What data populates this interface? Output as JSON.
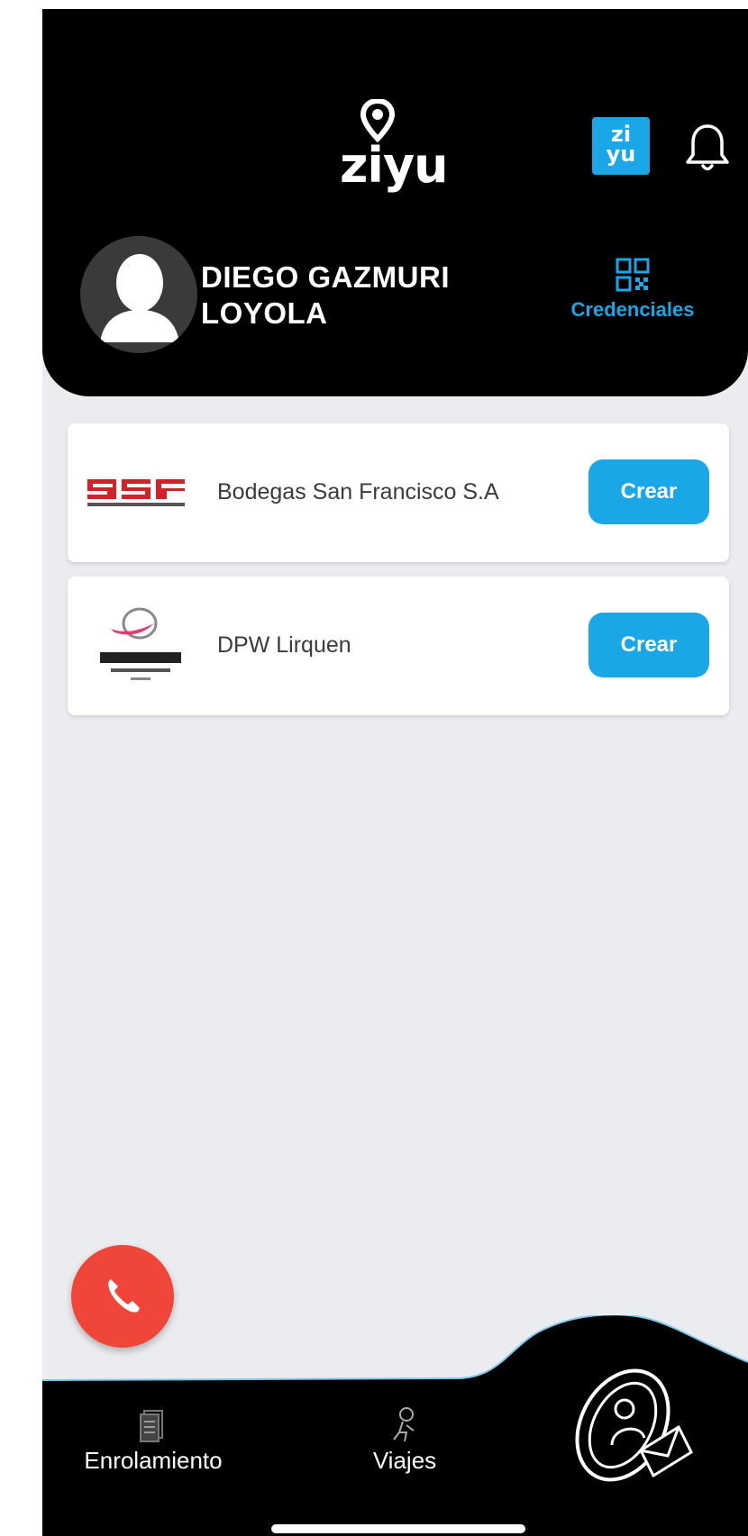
{
  "header": {
    "brand": "ziyu",
    "badge_top": "zi",
    "badge_bottom": "yu",
    "user_name": "DIEGO GAZMURI LOYOLA",
    "credentials_label": "Credenciales"
  },
  "companies": [
    {
      "logo": "bsf-logo",
      "name": "Bodegas San Francisco S.A",
      "button": "Crear"
    },
    {
      "logo": "dp-world-logo",
      "name": "DPW Lirquen",
      "button": "Crear"
    }
  ],
  "nav": {
    "items": [
      {
        "label": "Enrolamiento",
        "icon": "documents-icon"
      },
      {
        "label": "Viajes",
        "icon": "traveler-icon"
      },
      {
        "label": "",
        "icon": "contact-mail-icon"
      }
    ]
  },
  "colors": {
    "accent": "#1aa7e8",
    "call": "#f04539",
    "header_bg": "#000000",
    "screen_bg": "#ebecf0"
  }
}
